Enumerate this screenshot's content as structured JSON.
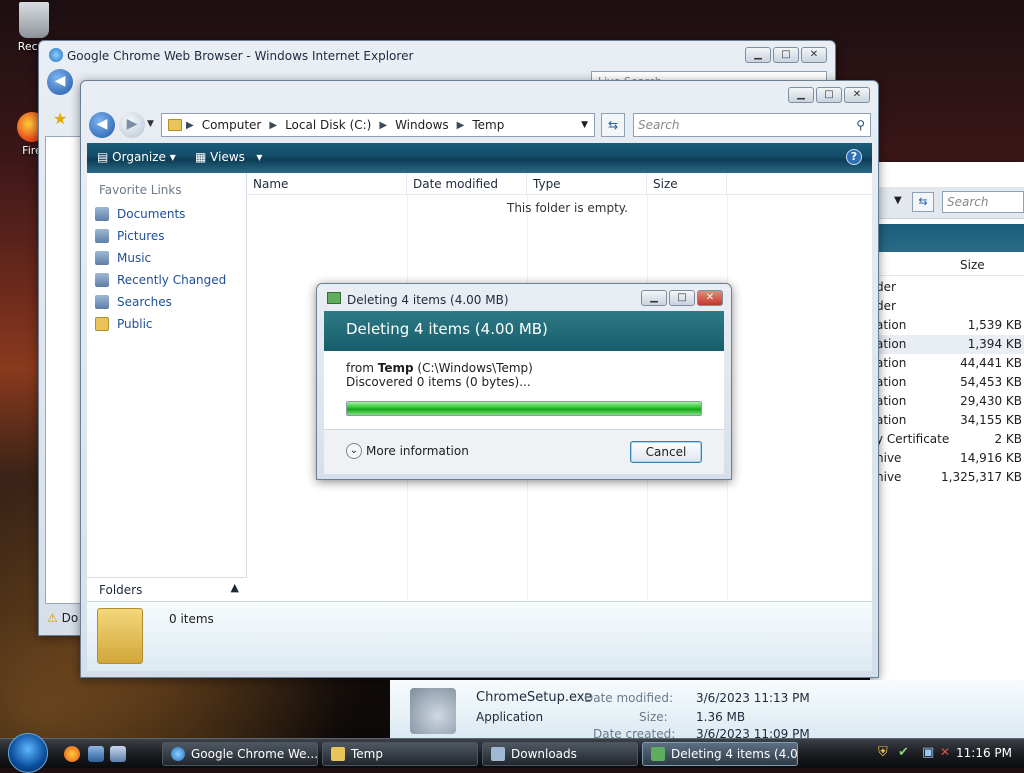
{
  "desktop": {
    "icons": [
      {
        "label": "Recyc",
        "icon": "recycle-bin-icon"
      },
      {
        "label": "Fire",
        "icon": "firefox-icon"
      }
    ]
  },
  "ie_window": {
    "title": "Google Chrome Web Browser - Windows Internet Explorer",
    "search_placeholder": "Live Search",
    "status_text": "Do"
  },
  "explorer": {
    "breadcrumb": [
      "Computer",
      "Local Disk (C:)",
      "Windows",
      "Temp"
    ],
    "search_placeholder": "Search",
    "toolbar": {
      "organize": "Organize",
      "views": "Views"
    },
    "favorite_links_header": "Favorite Links",
    "favorite_links": [
      "Documents",
      "Pictures",
      "Music",
      "Recently Changed",
      "Searches",
      "Public"
    ],
    "folders_label": "Folders",
    "columns": [
      "Name",
      "Date modified",
      "Type",
      "Size"
    ],
    "empty_message": "This folder is empty.",
    "details_count": "0 items"
  },
  "downloads_window": {
    "search_placeholder": "Search",
    "size_header": "Size",
    "rows": [
      {
        "type": "der",
        "size": ""
      },
      {
        "type": "der",
        "size": ""
      },
      {
        "type": "ation",
        "size": "1,539 KB"
      },
      {
        "type": "ation",
        "size": "1,394 KB"
      },
      {
        "type": "ation",
        "size": "44,441 KB"
      },
      {
        "type": "ation",
        "size": "54,453 KB"
      },
      {
        "type": "ation",
        "size": "29,430 KB"
      },
      {
        "type": "ation",
        "size": "34,155 KB"
      },
      {
        "type": "y Certificate",
        "size": "2 KB"
      },
      {
        "type": "hive",
        "size": "14,916 KB"
      },
      {
        "type": "hive",
        "size": "1,325,317 KB"
      }
    ],
    "details": {
      "file_name": "ChromeSetup.exe",
      "file_type": "Application",
      "date_modified_label": "Date modified:",
      "date_modified": "3/6/2023 11:13 PM",
      "size_label": "Size:",
      "size": "1.36 MB",
      "date_created_label": "Date created:",
      "date_created": "3/6/2023 11:09 PM"
    }
  },
  "dialog": {
    "title": "Deleting 4 items (4.00 MB)",
    "heading": "Deleting 4 items (4.00 MB)",
    "from_label": "from",
    "from_folder": "Temp",
    "from_path": "(C:\\Windows\\Temp)",
    "discovered": "Discovered 0 items (0 bytes)...",
    "progress": 1.0,
    "more_info": "More information",
    "cancel": "Cancel"
  },
  "taskbar": {
    "buttons": [
      {
        "label": "Google Chrome We...",
        "icon": "ie-icon"
      },
      {
        "label": "Temp",
        "icon": "folder-icon"
      },
      {
        "label": "Downloads",
        "icon": "folder-icon"
      },
      {
        "label": "Deleting 4 items (4.0...",
        "icon": "delete-progress-icon"
      }
    ],
    "clock": "11:16 PM"
  },
  "colors": {
    "accent": "#1f5aa8",
    "command_bar": "#134b66",
    "progress_green": "#27c42a",
    "link_blue": "#1f4e99"
  }
}
